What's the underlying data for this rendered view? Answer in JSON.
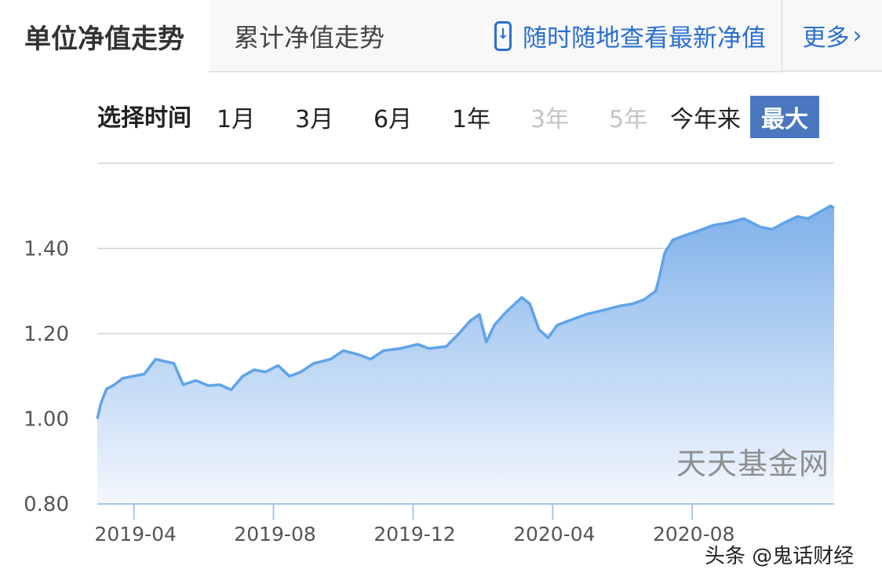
{
  "tabs": {
    "active_label": "单位净值走势",
    "inactive_label": "累计净值走势",
    "mobile_link": "随时随地查看最新净值",
    "more_label": "更多",
    "more_chevron": "›"
  },
  "range": {
    "label": "选择时间",
    "options": [
      {
        "label": "1月",
        "state": "normal"
      },
      {
        "label": "3月",
        "state": "normal"
      },
      {
        "label": "6月",
        "state": "normal"
      },
      {
        "label": "1年",
        "state": "normal"
      },
      {
        "label": "3年",
        "state": "disabled"
      },
      {
        "label": "5年",
        "state": "disabled"
      },
      {
        "label": "今年来",
        "state": "normal"
      },
      {
        "label": "最大",
        "state": "active"
      }
    ]
  },
  "colors": {
    "accent": "#4a77c0",
    "link": "#2a6fd1",
    "line": "#5fa3ea",
    "area_top": "#7fb1ea",
    "area_bottom": "#f4f8fd",
    "grid": "#d3d3d3"
  },
  "watermark": "天天基金网",
  "credit": "头条 @鬼话财经",
  "chart_data": {
    "type": "area",
    "title": "",
    "xlabel": "",
    "ylabel": "",
    "ylim": [
      0.8,
      1.6
    ],
    "yticks": [
      0.8,
      1.0,
      1.2,
      1.4
    ],
    "ytick_labels": [
      "0.80",
      "1.00",
      "1.20",
      "1.40"
    ],
    "xticks": [
      "2019-04",
      "2019-08",
      "2019-12",
      "2020-04",
      "2020-08"
    ],
    "grid": true,
    "legend": "none",
    "series": [
      {
        "values": [
          [
            "2019-02-28",
            1.0
          ],
          [
            "2019-03-03",
            1.035
          ],
          [
            "2019-03-08",
            1.07
          ],
          [
            "2019-03-15",
            1.08
          ],
          [
            "2019-03-22",
            1.095
          ],
          [
            "2019-03-31",
            1.1
          ],
          [
            "2019-04-10",
            1.105
          ],
          [
            "2019-04-20",
            1.14
          ],
          [
            "2019-04-28",
            1.135
          ],
          [
            "2019-05-06",
            1.13
          ],
          [
            "2019-05-14",
            1.08
          ],
          [
            "2019-05-25",
            1.09
          ],
          [
            "2019-06-05",
            1.078
          ],
          [
            "2019-06-15",
            1.08
          ],
          [
            "2019-06-25",
            1.068
          ],
          [
            "2019-07-05",
            1.1
          ],
          [
            "2019-07-15",
            1.115
          ],
          [
            "2019-07-25",
            1.11
          ],
          [
            "2019-08-05",
            1.125
          ],
          [
            "2019-08-15",
            1.1
          ],
          [
            "2019-08-25",
            1.11
          ],
          [
            "2019-09-05",
            1.13
          ],
          [
            "2019-09-20",
            1.14
          ],
          [
            "2019-10-01",
            1.16
          ],
          [
            "2019-10-15",
            1.15
          ],
          [
            "2019-10-25",
            1.14
          ],
          [
            "2019-11-05",
            1.16
          ],
          [
            "2019-11-20",
            1.165
          ],
          [
            "2019-12-05",
            1.175
          ],
          [
            "2019-12-15",
            1.165
          ],
          [
            "2019-12-30",
            1.17
          ],
          [
            "2020-01-10",
            1.2
          ],
          [
            "2020-01-20",
            1.23
          ],
          [
            "2020-01-28",
            1.245
          ],
          [
            "2020-02-03",
            1.18
          ],
          [
            "2020-02-10",
            1.22
          ],
          [
            "2020-02-20",
            1.25
          ],
          [
            "2020-02-28",
            1.27
          ],
          [
            "2020-03-05",
            1.285
          ],
          [
            "2020-03-12",
            1.27
          ],
          [
            "2020-03-20",
            1.21
          ],
          [
            "2020-03-28",
            1.19
          ],
          [
            "2020-04-05",
            1.22
          ],
          [
            "2020-04-15",
            1.23
          ],
          [
            "2020-04-30",
            1.245
          ],
          [
            "2020-05-15",
            1.255
          ],
          [
            "2020-05-30",
            1.265
          ],
          [
            "2020-06-10",
            1.27
          ],
          [
            "2020-06-20",
            1.28
          ],
          [
            "2020-06-30",
            1.3
          ],
          [
            "2020-07-03",
            1.33
          ],
          [
            "2020-07-08",
            1.39
          ],
          [
            "2020-07-15",
            1.42
          ],
          [
            "2020-07-25",
            1.43
          ],
          [
            "2020-08-05",
            1.44
          ],
          [
            "2020-08-20",
            1.455
          ],
          [
            "2020-09-01",
            1.46
          ],
          [
            "2020-09-15",
            1.47
          ],
          [
            "2020-09-30",
            1.45
          ],
          [
            "2020-10-10",
            1.445
          ],
          [
            "2020-10-20",
            1.46
          ],
          [
            "2020-11-01",
            1.475
          ],
          [
            "2020-11-10",
            1.47
          ],
          [
            "2020-11-20",
            1.485
          ],
          [
            "2020-11-30",
            1.5
          ],
          [
            "2020-12-03",
            1.495
          ]
        ]
      }
    ]
  }
}
